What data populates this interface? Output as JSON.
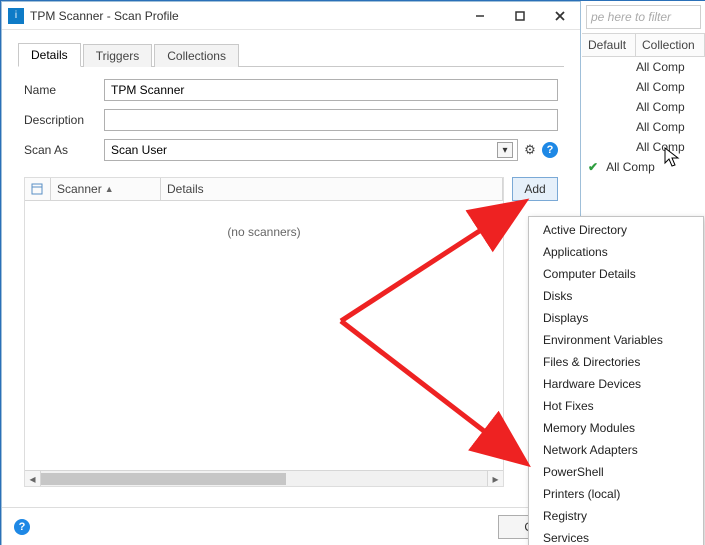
{
  "window": {
    "title": "TPM Scanner - Scan Profile",
    "icon_label": "i"
  },
  "tabs": {
    "details": "Details",
    "triggers": "Triggers",
    "collections": "Collections"
  },
  "form": {
    "name_label": "Name",
    "name_value": "TPM Scanner",
    "description_label": "Description",
    "description_value": "",
    "scanas_label": "Scan As",
    "scanas_value": "Scan User"
  },
  "grid": {
    "col_scanner": "Scanner",
    "col_details": "Details",
    "empty_text": "(no scanners)"
  },
  "add_label": "Add",
  "ok_label": "OK",
  "menu": [
    "Active Directory",
    "Applications",
    "Computer Details",
    "Disks",
    "Displays",
    "Environment Variables",
    "Files & Directories",
    "Hardware Devices",
    "Hot Fixes",
    "Memory Modules",
    "Network Adapters",
    "PowerShell",
    "Printers (local)",
    "Registry",
    "Services"
  ],
  "rightpanel": {
    "filter_placeholder": "pe here to filter",
    "col_default": "Default",
    "col_collection": "Collection",
    "rows": [
      "All Comp",
      "All Comp",
      "All Comp",
      "All Comp",
      "All Comp",
      "All Comp"
    ],
    "last_checked": true
  }
}
